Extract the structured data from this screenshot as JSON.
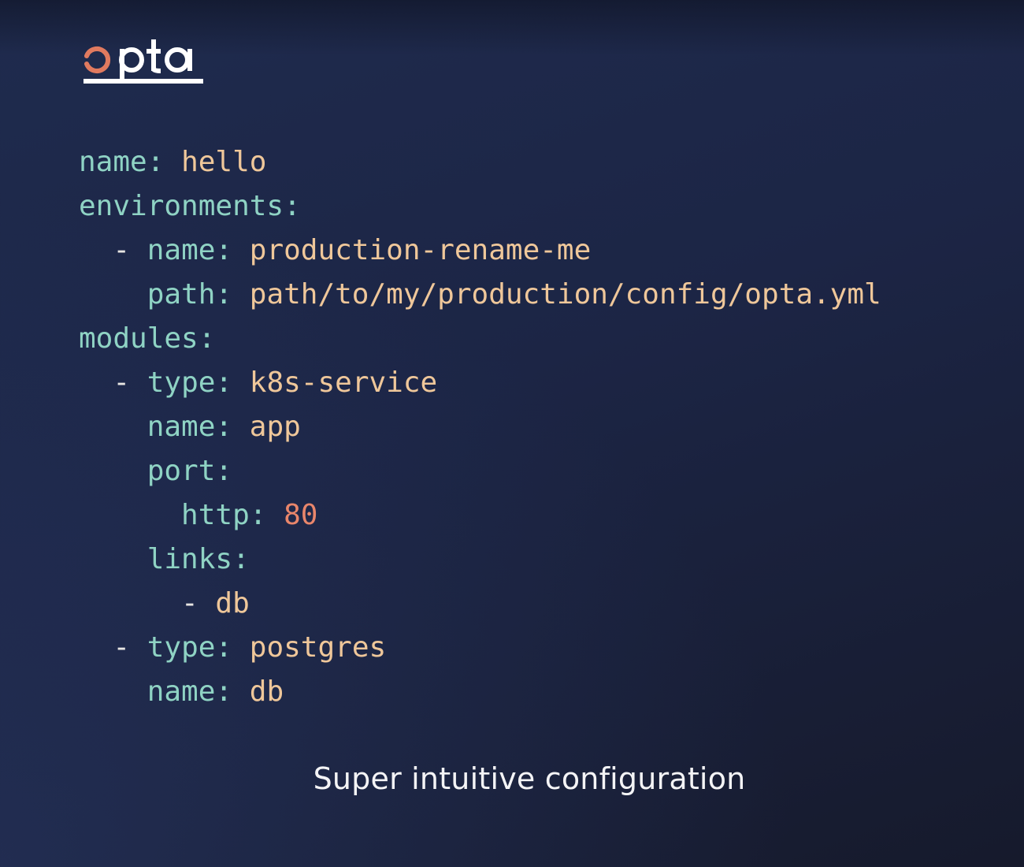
{
  "logo": {
    "text": "opta",
    "accent_color": "#e07a5f",
    "text_color": "#ffffff"
  },
  "colors": {
    "key": "#8fd3c4",
    "string": "#efc79a",
    "number": "#e9866b",
    "background": "#1f2b4e"
  },
  "code": {
    "lines": [
      {
        "indent": "",
        "dash": "",
        "key": "name:",
        "value": "hello",
        "value_type": "str"
      },
      {
        "indent": "",
        "dash": "",
        "key": "environments:",
        "value": "",
        "value_type": "str"
      },
      {
        "indent": "  ",
        "dash": "- ",
        "key": "name:",
        "value": "production-rename-me",
        "value_type": "str"
      },
      {
        "indent": "    ",
        "dash": "",
        "key": "path:",
        "value": "path/to/my/production/config/opta.yml",
        "value_type": "str"
      },
      {
        "indent": "",
        "dash": "",
        "key": "modules:",
        "value": "",
        "value_type": "str"
      },
      {
        "indent": "  ",
        "dash": "- ",
        "key": "type:",
        "value": "k8s-service",
        "value_type": "str"
      },
      {
        "indent": "    ",
        "dash": "",
        "key": "name:",
        "value": "app",
        "value_type": "str"
      },
      {
        "indent": "    ",
        "dash": "",
        "key": "port:",
        "value": "",
        "value_type": "str"
      },
      {
        "indent": "      ",
        "dash": "",
        "key": "http:",
        "value": "80",
        "value_type": "num"
      },
      {
        "indent": "    ",
        "dash": "",
        "key": "links:",
        "value": "",
        "value_type": "str"
      },
      {
        "indent": "      ",
        "dash": "- ",
        "key": "",
        "value": "db",
        "value_type": "str"
      },
      {
        "indent": "  ",
        "dash": "- ",
        "key": "type:",
        "value": "postgres",
        "value_type": "str"
      },
      {
        "indent": "    ",
        "dash": "",
        "key": "name:",
        "value": "db",
        "value_type": "str"
      }
    ]
  },
  "caption": "Super intuitive configuration"
}
